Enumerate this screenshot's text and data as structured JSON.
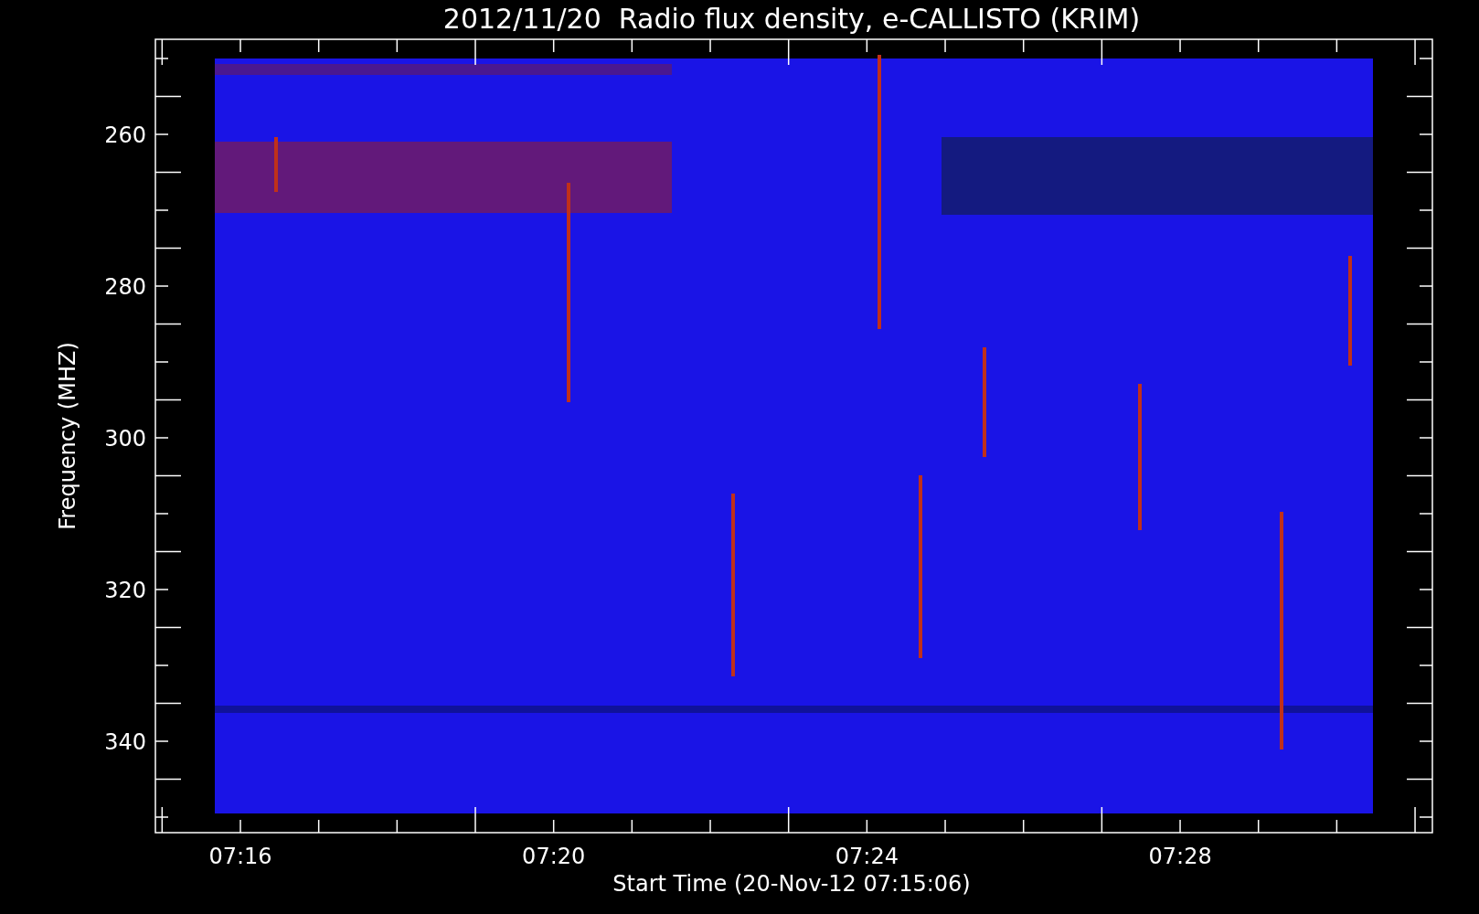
{
  "title": "2012/11/20  Radio flux density, e-CALLISTO (KRIM)",
  "y_axis": {
    "label": "Frequency (MHZ)",
    "ticks": [
      "260",
      "280",
      "300",
      "320",
      "340"
    ]
  },
  "x_axis": {
    "label": "Start Time (20-Nov-12 07:15:06)",
    "ticks": [
      "07:16",
      "07:20",
      "07:24",
      "07:28"
    ]
  }
}
